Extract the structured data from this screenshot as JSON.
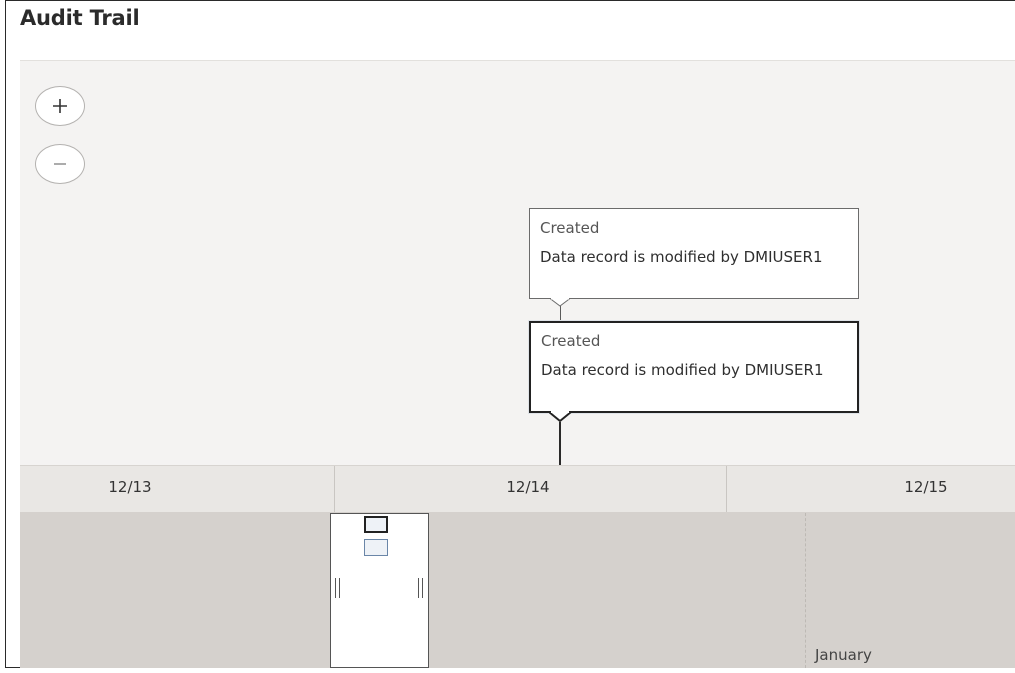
{
  "page": {
    "title": "Audit Trail"
  },
  "zoom": {
    "in_icon": "plus-icon",
    "out_icon": "minus-icon"
  },
  "events": [
    {
      "title": "Created",
      "description": "Data record is modified by DMIUSER1",
      "selected": false
    },
    {
      "title": "Created",
      "description": "Data record is modified by DMIUSER1",
      "selected": true
    }
  ],
  "timescale": {
    "ticks": [
      "12/13",
      "12/14",
      "12/15"
    ]
  },
  "overview": {
    "month_label": "January"
  },
  "colors": {
    "timeline_bg": "#f4f3f2",
    "overview_bg": "#d5d1cd",
    "selected_border": "#222222"
  }
}
